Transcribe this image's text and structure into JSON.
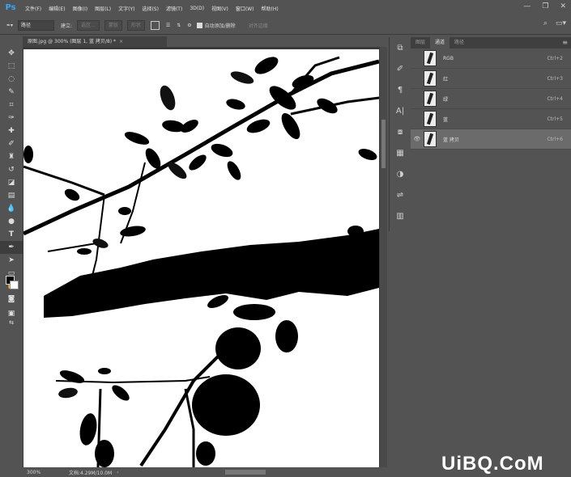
{
  "app": {
    "logo": "Ps"
  },
  "menu": [
    "文件(F)",
    "编辑(E)",
    "图像(I)",
    "图层(L)",
    "文字(Y)",
    "选择(S)",
    "滤镜(T)",
    "3D(D)",
    "视图(V)",
    "窗口(W)",
    "帮助(H)"
  ],
  "options": {
    "mode_value": "路径",
    "make_label": "建立:",
    "selection_btn": "选区...",
    "mask_btn": "蒙版",
    "shape_btn": "形状",
    "auto_add_delete": "自动添加/删除",
    "align_edges": "对齐边缘"
  },
  "document": {
    "tab_title": "原图.jpg @ 300% (图层 1, 蓝 拷贝/8) *",
    "close": "×"
  },
  "status": {
    "zoom": "300%",
    "doc": "文档:4.29M/10.0M"
  },
  "channels_panel": {
    "tabs": [
      "图层",
      "通道",
      "路径"
    ],
    "active_tab": 1,
    "channels": [
      {
        "name": "RGB",
        "shortcut": "Ctrl+2"
      },
      {
        "name": "红",
        "shortcut": "Ctrl+3"
      },
      {
        "name": "绿",
        "shortcut": "Ctrl+4"
      },
      {
        "name": "蓝",
        "shortcut": "Ctrl+5"
      },
      {
        "name": "蓝 拷贝",
        "shortcut": "Ctrl+6",
        "selected": true,
        "visible": true
      }
    ]
  },
  "watermark": "UiBQ.CoM",
  "colors": {
    "foreground": "#000000",
    "background": "#ffffff",
    "ps_blue": "#31a8ff"
  }
}
